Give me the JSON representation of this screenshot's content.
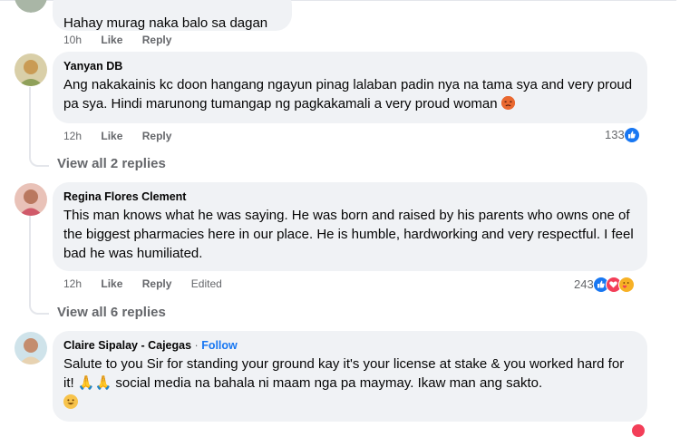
{
  "comments": [
    {
      "text": "Hahay murag naka balo sa dagan",
      "time": "10h",
      "like_label": "Like",
      "reply_label": "Reply"
    },
    {
      "author": "Yanyan DB",
      "text": "Ang nakakainis kc doon hangang ngayun pinag lalaban padin nya na tama sya and very proud pa sya. Hindi marunong tumangap ng pagkakamali a very proud woman",
      "time": "12h",
      "like_label": "Like",
      "reply_label": "Reply",
      "reaction_count": "133",
      "view_replies": "View all 2 replies"
    },
    {
      "author": "Regina Flores Clement",
      "text": "This man knows what he was saying. He was born and raised by his parents who owns one of the biggest pharmacies here in our place. He is humble, hardworking and very respectful. I feel bad he was humiliated.",
      "time": "12h",
      "like_label": "Like",
      "reply_label": "Reply",
      "edited_label": "Edited",
      "reaction_count": "243",
      "view_replies": "View all 6 replies"
    },
    {
      "author": "Claire Sipalay - Cajegas",
      "separator": "·",
      "follow_label": "Follow",
      "text": "Salute to you Sir for standing your ground kay it's your license at stake & you worked hard for it! 🙏🙏 social media na bahala ni maam nga pa maymay. Ikaw man ang sakto."
    }
  ],
  "colors": {
    "bubble": "#f0f2f5",
    "link_blue": "#1877f2",
    "secondary_text": "#65676b",
    "like_blue": "#1877f2",
    "love_red": "#f33e58",
    "care_yellow": "#f7b125"
  },
  "icons": {
    "like": "like-reaction-icon",
    "love": "love-reaction-icon",
    "care": "care-reaction-icon",
    "angry": "angry-emoji-icon",
    "smile": "smile-emoji-icon"
  }
}
